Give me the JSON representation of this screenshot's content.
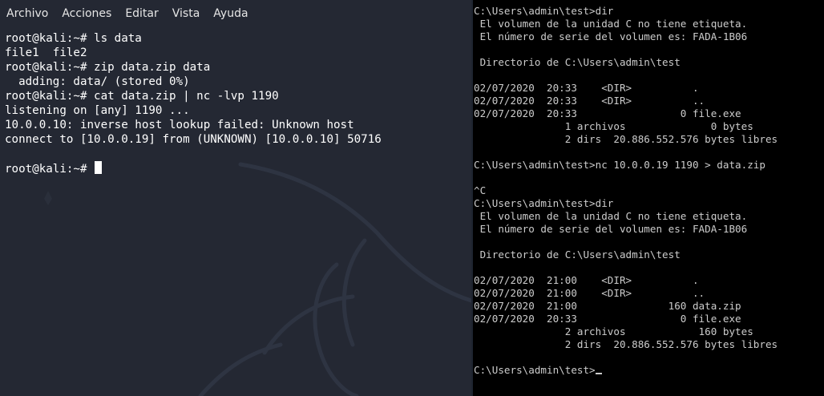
{
  "kali_window": {
    "menu": [
      "Archivo",
      "Acciones",
      "Editar",
      "Vista",
      "Ayuda"
    ],
    "lines": [
      "root@kali:~# ls data",
      "file1  file2",
      "root@kali:~# zip data.zip data",
      "  adding: data/ (stored 0%)",
      "root@kali:~# cat data.zip | nc -lvp 1190",
      "listening on [any] 1190 ...",
      "10.0.0.10: inverse host lookup failed: Unknown host",
      "connect to [10.0.0.19] from (UNKNOWN) [10.0.0.10] 50716",
      "",
      "root@kali:~# "
    ],
    "colors": {
      "background": "#242833",
      "text": "#ffffff",
      "menu_text": "#e6e6e6"
    }
  },
  "cmd_window": {
    "lines": [
      "C:\\Users\\admin\\test>dir",
      " El volumen de la unidad C no tiene etiqueta.",
      " El número de serie del volumen es: FADA-1B06",
      "",
      " Directorio de C:\\Users\\admin\\test",
      "",
      "02/07/2020  20:33    <DIR>          .",
      "02/07/2020  20:33    <DIR>          ..",
      "02/07/2020  20:33                 0 file.exe",
      "               1 archivos              0 bytes",
      "               2 dirs  20.886.552.576 bytes libres",
      "",
      "C:\\Users\\admin\\test>nc 10.0.0.19 1190 > data.zip",
      "",
      "^C",
      "C:\\Users\\admin\\test>dir",
      " El volumen de la unidad C no tiene etiqueta.",
      " El número de serie del volumen es: FADA-1B06",
      "",
      " Directorio de C:\\Users\\admin\\test",
      "",
      "02/07/2020  21:00    <DIR>          .",
      "02/07/2020  21:00    <DIR>          ..",
      "02/07/2020  21:00               160 data.zip",
      "02/07/2020  20:33                 0 file.exe",
      "               2 archivos            160 bytes",
      "               2 dirs  20.886.552.576 bytes libres",
      "",
      "C:\\Users\\admin\\test>"
    ],
    "colors": {
      "background": "#000000",
      "text": "#cccccc"
    }
  }
}
